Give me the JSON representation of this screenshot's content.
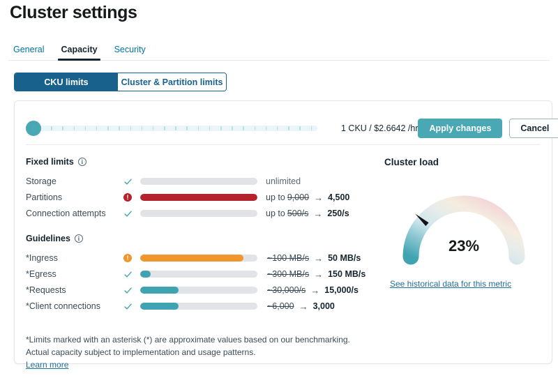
{
  "header": {
    "title": "Cluster settings"
  },
  "tabs": [
    {
      "label": "General",
      "active": false
    },
    {
      "label": "Capacity",
      "active": true
    },
    {
      "label": "Security",
      "active": false
    }
  ],
  "segmented": {
    "selected": "CKU limits",
    "options": [
      {
        "label": "CKU limits",
        "selected": true
      },
      {
        "label": "Cluster & Partition limits",
        "selected": false
      }
    ]
  },
  "slider": {
    "value_label": "1 CKU / $2.6642 /hr",
    "thumb_position_percent": 0,
    "tick_count": 25
  },
  "actions": {
    "apply_label": "Apply changes",
    "cancel_label": "Cancel"
  },
  "fixed_limits": {
    "title": "Fixed limits",
    "info_icon": "info-icon",
    "rows": [
      {
        "label": "Storage",
        "status": "ok",
        "status_icon": "check-icon",
        "bar_percent": 0,
        "bar_color": "#e1e3e6",
        "prefix": "",
        "old_value": "",
        "new_value": "",
        "plain_value": "unlimited"
      },
      {
        "label": "Partitions",
        "status": "error",
        "status_icon": "alert-icon",
        "bar_percent": 100,
        "bar_color": "#b4232c",
        "prefix": "up to",
        "old_value": "9,000",
        "new_value": "4,500",
        "plain_value": ""
      },
      {
        "label": "Connection attempts",
        "status": "ok",
        "status_icon": "check-icon",
        "bar_percent": 0,
        "bar_color": "#e1e3e6",
        "prefix": "up to",
        "old_value": "500/s",
        "new_value": "250/s",
        "plain_value": ""
      }
    ]
  },
  "guidelines": {
    "title": "Guidelines",
    "info_icon": "info-icon",
    "rows": [
      {
        "label": "*Ingress",
        "status": "warning",
        "status_icon": "alert-icon",
        "bar_percent": 88,
        "bar_color": "#f0962c",
        "prefix": "",
        "old_value": "~100 MB/s",
        "new_value": "50 MB/s",
        "plain_value": ""
      },
      {
        "label": "*Egress",
        "status": "ok",
        "status_icon": "check-icon",
        "bar_percent": 9,
        "bar_color": "#3fa3b1",
        "prefix": "",
        "old_value": "~300 MB/s",
        "new_value": "150 MB/s",
        "plain_value": ""
      },
      {
        "label": "*Requests",
        "status": "ok",
        "status_icon": "check-icon",
        "bar_percent": 33,
        "bar_color": "#3fa3b1",
        "prefix": "",
        "old_value": "~30,000/s",
        "new_value": "15,000/s",
        "plain_value": ""
      },
      {
        "label": "*Client connections",
        "status": "ok",
        "status_icon": "check-icon",
        "bar_percent": 33,
        "bar_color": "#3fa3b1",
        "prefix": "",
        "old_value": "~6,000",
        "new_value": "3,000",
        "plain_value": ""
      }
    ]
  },
  "footnote": {
    "line1": "*Limits marked with an asterisk (*) are approximate values based on our benchmarking.",
    "line2": "Actual capacity subject to implementation and usage patterns.",
    "learn_more": "Learn more"
  },
  "cluster_load": {
    "title": "Cluster load",
    "value_label": "23%",
    "value_percent": 23,
    "link_label": "See historical data for this metric",
    "gauge_colors": {
      "start": "#3fa3b1",
      "mid_low": "#cfe6ec",
      "mid": "#f3ece0",
      "end": "#f3ccd5",
      "needle": "#101418"
    }
  }
}
